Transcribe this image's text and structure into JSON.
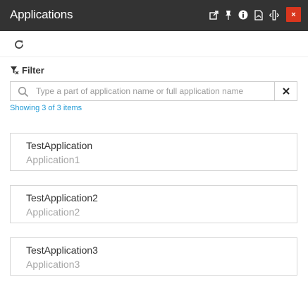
{
  "window": {
    "title": "Applications",
    "close_label": "×",
    "accent_color": "#d9361e"
  },
  "toolbar": {
    "refresh_icon": "refresh-icon"
  },
  "filter": {
    "label": "Filter",
    "icon": "filter-icon",
    "search_placeholder": "Type a part of application name or full application name",
    "search_value": "",
    "clear_icon": "close-icon",
    "status": "Showing 3 of 3 items",
    "status_color": "#1f9ad6"
  },
  "applications": [
    {
      "name": "TestApplication",
      "subtitle": "Application1"
    },
    {
      "name": "TestApplication2",
      "subtitle": "Application2"
    },
    {
      "name": "TestApplication3",
      "subtitle": "Application3"
    }
  ]
}
